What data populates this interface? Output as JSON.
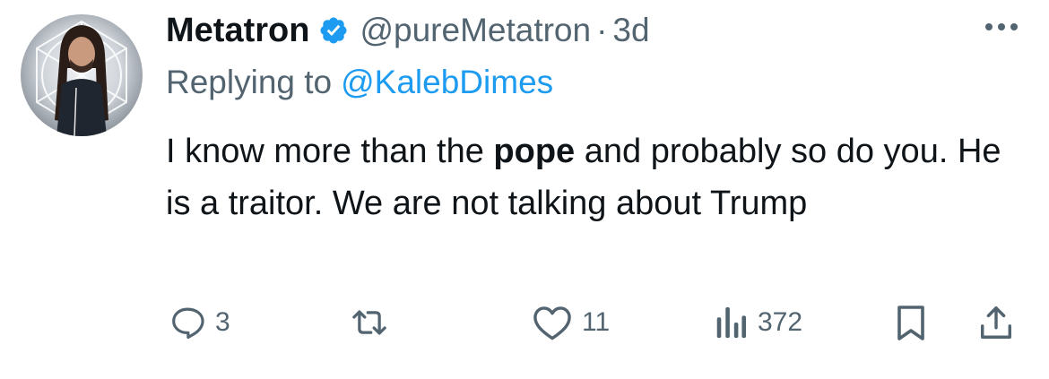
{
  "tweet": {
    "display_name": "Metatron",
    "handle": "@pureMetatron",
    "separator": "·",
    "time": "3d",
    "replying_prefix": "Replying to",
    "replying_to": "@KalebDimes",
    "text_before": "I know more than the ",
    "text_bold": "pope",
    "text_after": " and probably so do you. He is a traitor. We are not talking about Trump"
  },
  "actions": {
    "replies": "3",
    "likes": "11",
    "views": "372"
  },
  "icons": {
    "avatar": "avatar",
    "verified": "verified-badge-icon",
    "more": "more-icon",
    "reply": "reply-icon",
    "retweet": "retweet-icon",
    "like": "heart-icon",
    "views": "views-icon",
    "bookmark": "bookmark-icon",
    "share": "share-icon"
  },
  "colors": {
    "accent": "#1d9bf0",
    "secondary_text": "#536471",
    "primary_text": "#0f1419"
  }
}
